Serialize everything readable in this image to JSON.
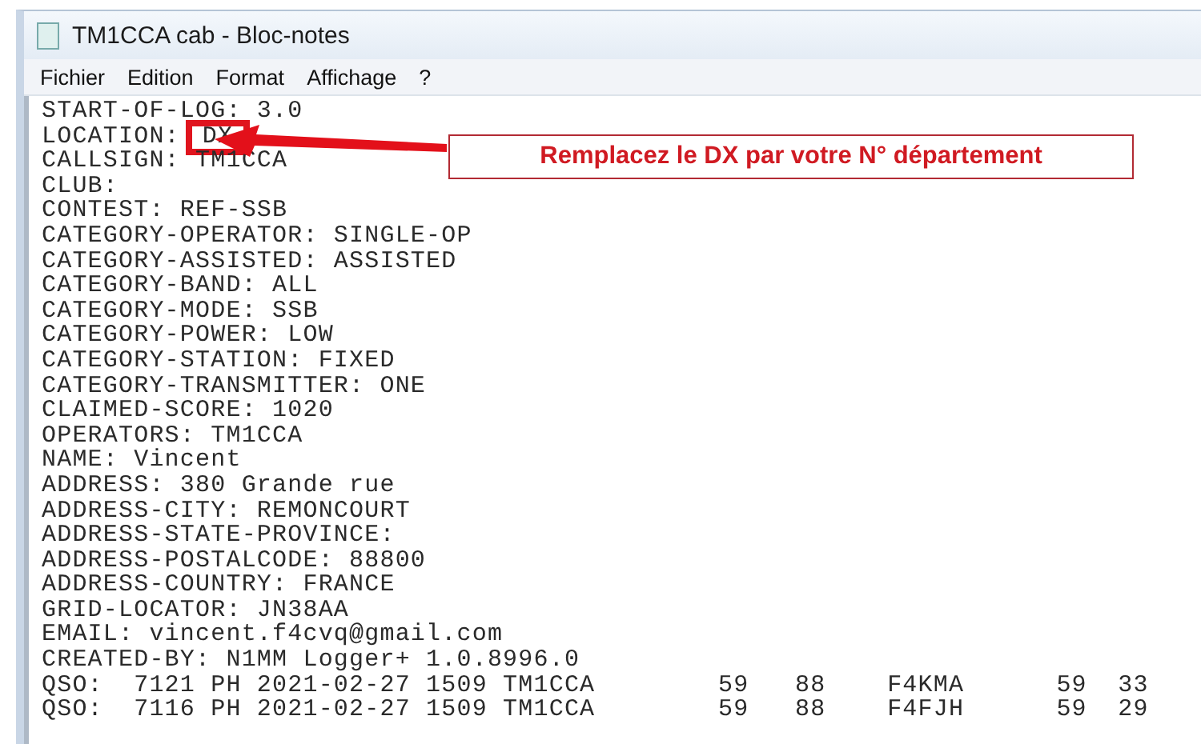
{
  "window": {
    "title": "TM1CCA cab - Bloc-notes"
  },
  "menu": [
    "Fichier",
    "Edition",
    "Format",
    "Affichage",
    "?"
  ],
  "document": {
    "lines": [
      {
        "kind": "plain",
        "text": "START-OF-LOG: 3.0"
      },
      {
        "kind": "boxed",
        "label": "LOCATION:",
        "value": "DX"
      },
      {
        "kind": "plain",
        "text": "CALLSIGN: TM1CCA"
      },
      {
        "kind": "plain",
        "text": "CLUB:"
      },
      {
        "kind": "plain",
        "text": "CONTEST: REF-SSB"
      },
      {
        "kind": "plain",
        "text": "CATEGORY-OPERATOR: SINGLE-OP"
      },
      {
        "kind": "plain",
        "text": "CATEGORY-ASSISTED: ASSISTED"
      },
      {
        "kind": "plain",
        "text": "CATEGORY-BAND: ALL"
      },
      {
        "kind": "plain",
        "text": "CATEGORY-MODE: SSB"
      },
      {
        "kind": "plain",
        "text": "CATEGORY-POWER: LOW"
      },
      {
        "kind": "plain",
        "text": "CATEGORY-STATION: FIXED"
      },
      {
        "kind": "plain",
        "text": "CATEGORY-TRANSMITTER: ONE"
      },
      {
        "kind": "plain",
        "text": "CLAIMED-SCORE: 1020"
      },
      {
        "kind": "plain",
        "text": "OPERATORS: TM1CCA"
      },
      {
        "kind": "plain",
        "text": "NAME: Vincent"
      },
      {
        "kind": "plain",
        "text": "ADDRESS: 380 Grande rue"
      },
      {
        "kind": "plain",
        "text": "ADDRESS-CITY: REMONCOURT"
      },
      {
        "kind": "plain",
        "text": "ADDRESS-STATE-PROVINCE:"
      },
      {
        "kind": "plain",
        "text": "ADDRESS-POSTALCODE: 88800"
      },
      {
        "kind": "plain",
        "text": "ADDRESS-COUNTRY: FRANCE"
      },
      {
        "kind": "plain",
        "text": "GRID-LOCATOR: JN38AA"
      },
      {
        "kind": "plain",
        "text": "EMAIL: vincent.f4cvq@gmail.com"
      },
      {
        "kind": "plain",
        "text": "CREATED-BY: N1MM Logger+ 1.0.8996.0"
      },
      {
        "kind": "plain",
        "text": "QSO:  7121 PH 2021-02-27 1509 TM1CCA        59   88    F4KMA      59  33"
      },
      {
        "kind": "plain",
        "text": "QSO:  7116 PH 2021-02-27 1509 TM1CCA        59   88    F4FJH      59  29"
      }
    ]
  },
  "annotation": {
    "text": "Remplacez le DX par votre N° département"
  }
}
